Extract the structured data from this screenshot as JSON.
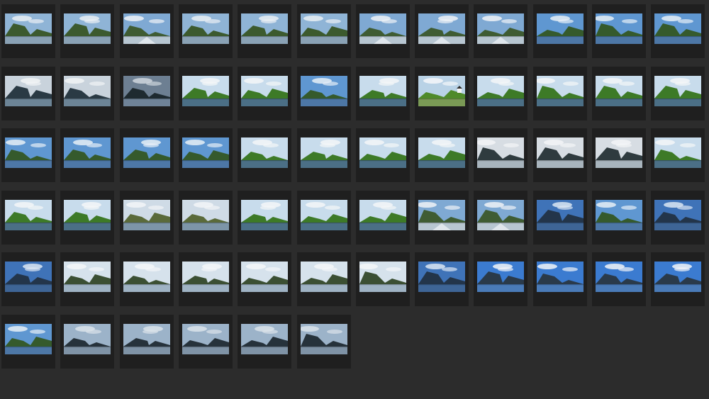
{
  "app": {
    "title": "",
    "colors": {
      "background": "#2c2c2c",
      "cell": "#1f1f1f"
    }
  },
  "grid": {
    "columns": 12,
    "items": [
      {
        "id": 1,
        "scene": "fjord-cloudy"
      },
      {
        "id": 2,
        "scene": "fjord-cloudy"
      },
      {
        "id": 3,
        "scene": "fjord-wake"
      },
      {
        "id": 4,
        "scene": "fjord-cloudy"
      },
      {
        "id": 5,
        "scene": "fjord-cloudy"
      },
      {
        "id": 6,
        "scene": "fjord-cloudy"
      },
      {
        "id": 7,
        "scene": "fjord-wake"
      },
      {
        "id": 8,
        "scene": "fjord-wake"
      },
      {
        "id": 9,
        "scene": "fjord-wake"
      },
      {
        "id": 10,
        "scene": "fjord-blue"
      },
      {
        "id": 11,
        "scene": "fjord-blue"
      },
      {
        "id": 12,
        "scene": "fjord-blue"
      },
      {
        "id": 13,
        "scene": "fjord-dark"
      },
      {
        "id": 14,
        "scene": "fjord-dark"
      },
      {
        "id": 15,
        "scene": "fjord-storm"
      },
      {
        "id": 16,
        "scene": "forest"
      },
      {
        "id": 17,
        "scene": "forest"
      },
      {
        "id": 18,
        "scene": "fjord-blue"
      },
      {
        "id": 19,
        "scene": "forest"
      },
      {
        "id": 20,
        "scene": "forest-house"
      },
      {
        "id": 21,
        "scene": "forest"
      },
      {
        "id": 22,
        "scene": "forest"
      },
      {
        "id": 23,
        "scene": "forest"
      },
      {
        "id": 24,
        "scene": "forest"
      },
      {
        "id": 25,
        "scene": "fjord-blue"
      },
      {
        "id": 26,
        "scene": "fjord-blue"
      },
      {
        "id": 27,
        "scene": "fjord-blue"
      },
      {
        "id": 28,
        "scene": "fjord-blue"
      },
      {
        "id": 29,
        "scene": "forest"
      },
      {
        "id": 30,
        "scene": "forest"
      },
      {
        "id": 31,
        "scene": "forest"
      },
      {
        "id": 32,
        "scene": "forest"
      },
      {
        "id": 33,
        "scene": "fjord-grey"
      },
      {
        "id": 34,
        "scene": "fjord-grey"
      },
      {
        "id": 35,
        "scene": "fjord-grey"
      },
      {
        "id": 36,
        "scene": "forest"
      },
      {
        "id": 37,
        "scene": "forest"
      },
      {
        "id": 38,
        "scene": "forest"
      },
      {
        "id": 39,
        "scene": "cliff"
      },
      {
        "id": 40,
        "scene": "cliff"
      },
      {
        "id": 41,
        "scene": "forest"
      },
      {
        "id": 42,
        "scene": "forest"
      },
      {
        "id": 43,
        "scene": "forest"
      },
      {
        "id": 44,
        "scene": "fjord-wake"
      },
      {
        "id": 45,
        "scene": "fjord-wake"
      },
      {
        "id": 46,
        "scene": "sky-blue"
      },
      {
        "id": 47,
        "scene": "fjord-blue"
      },
      {
        "id": 48,
        "scene": "sky-blue"
      },
      {
        "id": 49,
        "scene": "sky-blue"
      },
      {
        "id": 50,
        "scene": "fjord-flat"
      },
      {
        "id": 51,
        "scene": "fjord-flat"
      },
      {
        "id": 52,
        "scene": "fjord-flat"
      },
      {
        "id": 53,
        "scene": "fjord-flat"
      },
      {
        "id": 54,
        "scene": "fjord-flat"
      },
      {
        "id": 55,
        "scene": "fjord-flat"
      },
      {
        "id": 56,
        "scene": "sky-blue"
      },
      {
        "id": 57,
        "scene": "sky-clouds"
      },
      {
        "id": 58,
        "scene": "sky-clouds"
      },
      {
        "id": 59,
        "scene": "sky-clouds"
      },
      {
        "id": 60,
        "scene": "sky-clouds"
      },
      {
        "id": 61,
        "scene": "fjord-blue"
      },
      {
        "id": 62,
        "scene": "sky-dusk"
      },
      {
        "id": 63,
        "scene": "sky-dusk"
      },
      {
        "id": 64,
        "scene": "sky-dusk"
      },
      {
        "id": 65,
        "scene": "sky-dusk"
      },
      {
        "id": 66,
        "scene": "sky-dusk"
      }
    ]
  },
  "scenes": {
    "fjord-cloudy": {
      "sky": "#8fb4d6",
      "cloud": "#e9eef3",
      "land": "#3c5a2e",
      "water": "#8aa2b5"
    },
    "fjord-wake": {
      "sky": "#7fa9d3",
      "cloud": "#eef2f6",
      "land": "#3f5c33",
      "water": "#b7c6d1"
    },
    "fjord-blue": {
      "sky": "#5f97d1",
      "cloud": "#e6eef6",
      "land": "#355a2c",
      "water": "#4d77a6"
    },
    "fjord-dark": {
      "sky": "#c9d3dc",
      "cloud": "#f1f3f5",
      "land": "#2a3a44",
      "water": "#6c8496"
    },
    "fjord-storm": {
      "sky": "#6d7f92",
      "cloud": "#cfd6dd",
      "land": "#1e2a30",
      "water": "#6f8398"
    },
    "forest": {
      "sky": "#c8dcec",
      "cloud": "#f3f6f8",
      "land": "#3d7a27",
      "water": "#4b6f86"
    },
    "forest-house": {
      "sky": "#b9d2e6",
      "cloud": "#f4f7f9",
      "land": "#4f8a2a",
      "water": "#7a9a55"
    },
    "fjord-grey": {
      "sky": "#d7dde3",
      "cloud": "#f3f5f7",
      "land": "#2f3b3f",
      "water": "#a8b4bd"
    },
    "cliff": {
      "sky": "#cfdbe6",
      "cloud": "#f2f5f7",
      "land": "#5a6a3a",
      "water": "#7d95a8"
    },
    "sky-blue": {
      "sky": "#3f73b8",
      "cloud": "#dbe6f2",
      "land": "#23354a",
      "water": "#3e6596"
    },
    "fjord-flat": {
      "sky": "#d6e2ec",
      "cloud": "#f4f7f9",
      "land": "#3b4f33",
      "water": "#9fb3c4"
    },
    "sky-clouds": {
      "sky": "#3b7bd0",
      "cloud": "#f1f4f8",
      "land": "#2a3a4a",
      "water": "#4a7bb8"
    },
    "sky-dusk": {
      "sky": "#9cb3c9",
      "cloud": "#dbe3ea",
      "land": "#26323b",
      "water": "#7f93a6"
    }
  }
}
